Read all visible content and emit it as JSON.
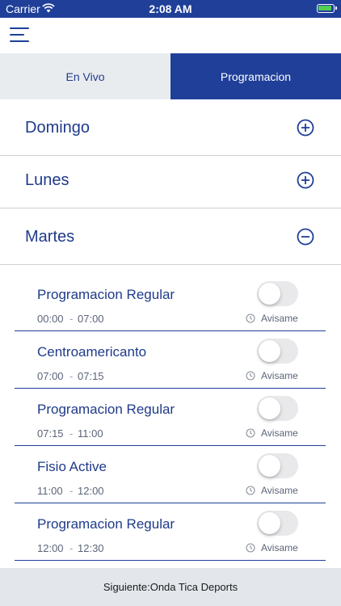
{
  "status_bar": {
    "carrier": "Carrier",
    "time": "2:08 AM",
    "wifi_icon": "wifi-icon",
    "battery_icon": "battery-charging-icon"
  },
  "nav": {
    "menu_icon": "hamburger-menu-icon"
  },
  "tabs": [
    {
      "label": "En Vivo",
      "active": false
    },
    {
      "label": "Programacion",
      "active": true
    }
  ],
  "days": [
    {
      "label": "Domingo",
      "expanded": false,
      "icon": "plus-circle-icon"
    },
    {
      "label": "Lunes",
      "expanded": false,
      "icon": "plus-circle-icon"
    },
    {
      "label": "Martes",
      "expanded": true,
      "icon": "minus-circle-icon"
    }
  ],
  "programs": [
    {
      "title": "Programacion Regular",
      "start": "00:00",
      "end": "07:00",
      "dash": "-",
      "reminder_label": "Avisame",
      "reminder_on": false
    },
    {
      "title": "Centroamericanto",
      "start": "07:00",
      "end": "07:15",
      "dash": "-",
      "reminder_label": "Avisame",
      "reminder_on": false
    },
    {
      "title": "Programacion Regular",
      "start": "07:15",
      "end": "11:00",
      "dash": "-",
      "reminder_label": "Avisame",
      "reminder_on": false
    },
    {
      "title": "Fisio Active",
      "start": "11:00",
      "end": "12:00",
      "dash": "-",
      "reminder_label": "Avisame",
      "reminder_on": false
    },
    {
      "title": "Programacion Regular",
      "start": "12:00",
      "end": "12:30",
      "dash": "-",
      "reminder_label": "Avisame",
      "reminder_on": false
    }
  ],
  "footer": {
    "next_label": "Siguiente:Onda Tica Deports"
  },
  "colors": {
    "brand": "#1f3f99",
    "text": "#1f3a8a",
    "tab_inactive_bg": "#e9ecef",
    "footer_bg": "#e3e7ec"
  }
}
